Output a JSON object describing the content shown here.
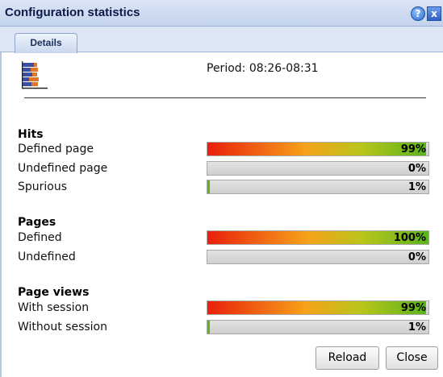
{
  "window": {
    "title": "Configuration statistics",
    "help_glyph": "?",
    "close_glyph": "x"
  },
  "tabs": [
    {
      "label": "Details"
    }
  ],
  "header": {
    "period": "Period: 08:26-08:31",
    "icon": "stats-chart-icon"
  },
  "sections": {
    "hits": {
      "title": "Hits",
      "rows": [
        {
          "label": "Defined page",
          "percent": 99,
          "text": "99%"
        },
        {
          "label": "Undefined page",
          "percent": 0,
          "text": "0%"
        },
        {
          "label": "Spurious",
          "percent": 1,
          "text": "1%"
        }
      ]
    },
    "pages": {
      "title": "Pages",
      "rows": [
        {
          "label": "Defined",
          "percent": 100,
          "text": "100%"
        },
        {
          "label": "Undefined",
          "percent": 0,
          "text": "0%"
        }
      ]
    },
    "page_views": {
      "title": "Page views",
      "rows": [
        {
          "label": "With session",
          "percent": 99,
          "text": "99%"
        },
        {
          "label": "Without session",
          "percent": 1,
          "text": "1%"
        }
      ]
    }
  },
  "buttons": {
    "reload": "Reload",
    "close": "Close"
  },
  "colors": {
    "titlebar": "#c3d3ec",
    "bar_start": "#e8200a",
    "bar_end": "#5ab41e"
  }
}
